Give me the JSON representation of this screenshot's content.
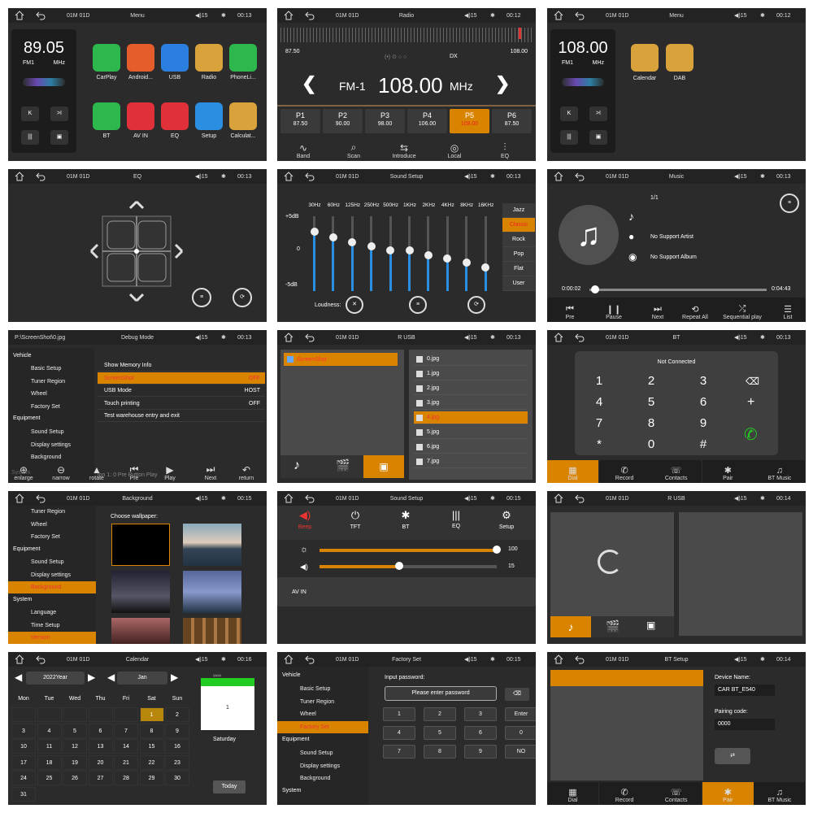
{
  "status": [
    {
      "sid": "01M 01D",
      "title": "Menu",
      "vol": "15",
      "time": "00:13"
    },
    {
      "sid": "01M 01D",
      "title": "Radio",
      "vol": "15",
      "time": "00:12"
    },
    {
      "sid": "01M 01D",
      "title": "Menu",
      "vol": "15",
      "time": "00:12"
    },
    {
      "sid": "01M 01D",
      "title": "EQ",
      "vol": "15",
      "time": "00:13"
    },
    {
      "sid": "01M 01D",
      "title": "Sound Setup",
      "vol": "15",
      "time": "00:13"
    },
    {
      "sid": "01M 01D",
      "title": "Music",
      "vol": "15",
      "time": "00:13"
    },
    {
      "sid": "P:\\ScreenShot\\0.jpg",
      "title": "Debug Mode",
      "vol": "15",
      "time": "00:13"
    },
    {
      "sid": "01M 01D",
      "title": "R USB",
      "vol": "15",
      "time": "00:13"
    },
    {
      "sid": "01M 01D",
      "title": "BT",
      "vol": "15",
      "time": "00:13"
    },
    {
      "sid": "01M 01D",
      "title": "Background",
      "vol": "15",
      "time": "00:15"
    },
    {
      "sid": "01M 01D",
      "title": "Sound Setup",
      "vol": "15",
      "time": "00:15"
    },
    {
      "sid": "01M 01D",
      "title": "R USB",
      "vol": "15",
      "time": "00:14"
    },
    {
      "sid": "01M 01D",
      "title": "Calendar",
      "vol": "15",
      "time": "00:16"
    },
    {
      "sid": "01M 01D",
      "title": "Factory Set",
      "vol": "15",
      "time": "00:15"
    },
    {
      "sid": "01M 01D",
      "title": "BT Setup",
      "vol": "15",
      "time": "00:14"
    }
  ],
  "menu1": {
    "freq": "89.05",
    "band": "FM1",
    "unit": "MHz",
    "apps": [
      "CarPlay",
      "Android...",
      "USB",
      "Radio",
      "PhoneLi...",
      "BT",
      "AV IN",
      "EQ",
      "Setup",
      "Calculat..."
    ],
    "colors": [
      "#2db84d",
      "#e45d2a",
      "#2a7fe0",
      "#d9a23a",
      "#2db84d",
      "#2db84d",
      "#e0303a",
      "#e0303a",
      "#2a8fe0",
      "#d9a23a"
    ]
  },
  "radio": {
    "min": "87.50",
    "max": "108.00",
    "dx": "DX",
    "band": "FM-1",
    "freq": "108.00",
    "unit": "MHz",
    "presets": [
      {
        "p": "P1",
        "f": "87.50"
      },
      {
        "p": "P2",
        "f": "90.00"
      },
      {
        "p": "P3",
        "f": "98.00"
      },
      {
        "p": "P4",
        "f": "106.00"
      },
      {
        "p": "P5",
        "f": "108.00"
      },
      {
        "p": "P6",
        "f": "87.50"
      }
    ],
    "buttons": [
      "Band",
      "Scan",
      "Introduce",
      "Local",
      "EQ"
    ]
  },
  "menu2": {
    "freq": "108.00",
    "band": "FM1",
    "unit": "MHz",
    "apps": [
      "Calendar",
      "DAB"
    ]
  },
  "sound": {
    "freqs": [
      "30Hz",
      "60Hz",
      "125Hz",
      "250Hz",
      "500Hz",
      "1KHz",
      "2KHz",
      "4KHz",
      "8KHz",
      "16KHz"
    ],
    "levels": [
      0.79,
      0.72,
      0.65,
      0.6,
      0.54,
      0.54,
      0.48,
      0.43,
      0.38,
      0.31
    ],
    "top": "+5dB",
    "mid": "0",
    "bot": "-5dB",
    "presets": [
      "Jazz",
      "Classic",
      "Rock",
      "Pop",
      "Flat",
      "User"
    ],
    "loudness": "Loudness:"
  },
  "music": {
    "track": "1/1",
    "artist": "No Support Artist",
    "album": "No Support Album",
    "cur": "0:00:02",
    "total": "0:04:43",
    "progress": 0.03,
    "buttons": [
      "Pre",
      "Pause",
      "Next",
      "Repeat All",
      "Sequential play",
      "List"
    ]
  },
  "debug": {
    "groups": [
      "Vehicle",
      "Equipment",
      "System"
    ],
    "vehicle": [
      "Basic Setup",
      "Tuner Region",
      "Wheel",
      "Factory Set"
    ],
    "equipment": [
      "Sound Setup",
      "Display settings",
      "Background"
    ],
    "items": [
      {
        "k": "Show Memory Info",
        "v": ""
      },
      {
        "k": "ScreenShot",
        "v": "OFF"
      },
      {
        "k": "USB Mode",
        "v": "HOST"
      },
      {
        "k": "Touch printing",
        "v": "OFF"
      },
      {
        "k": "Test warehouse entry and exit",
        "v": ""
      }
    ],
    "tools": [
      "enlarge",
      "narrow",
      "rotate",
      "Pre",
      "Play",
      "Next",
      "return"
    ],
    "ghost": "ion 1:  0   Pre   Button  Play"
  },
  "rusb": {
    "folder": "ScreenShot",
    "files": [
      "0.jpg",
      "1.jpg",
      "2.jpg",
      "3.jpg",
      "4.jpg",
      "5.jpg",
      "6.jpg",
      "7.jpg"
    ]
  },
  "bt": {
    "state": "Not Connected",
    "keys": [
      "1",
      "2",
      "3",
      "4",
      "5",
      "6",
      "7",
      "8",
      "9",
      "*",
      "0",
      "#"
    ],
    "plus": "+",
    "tabs": [
      "Dial",
      "Record",
      "Contacts",
      "Pair",
      "BT Music"
    ]
  },
  "bg": {
    "choose": "Choose wallpaper:",
    "left": [
      "Tuner Region",
      "Wheel",
      "Factory Set",
      "Equipment",
      "Sound Setup",
      "Display settings",
      "Background",
      "System",
      "Language",
      "Time Setup",
      "Version"
    ]
  },
  "sound2": {
    "icons": [
      "Beep",
      "TFT",
      "BT",
      "EQ",
      "Setup"
    ],
    "v1": "100",
    "v2": "15",
    "av": "AV IN",
    "s1": 1.0,
    "s2": 0.45
  },
  "cal": {
    "year": "2022Year",
    "month": "Jan",
    "days": [
      "Mon",
      "Tue",
      "Wed",
      "Thu",
      "Fri",
      "Sat",
      "Sun"
    ],
    "dates": [
      "",
      "",
      "",
      "",
      "",
      "1",
      "2",
      "3",
      "4",
      "5",
      "6",
      "7",
      "8",
      "9",
      "10",
      "11",
      "12",
      "13",
      "14",
      "15",
      "16",
      "17",
      "18",
      "19",
      "20",
      "21",
      "22",
      "23",
      "24",
      "25",
      "26",
      "27",
      "28",
      "29",
      "30",
      "31"
    ],
    "sel": "1",
    "dow": "Saturday",
    "today": "Today"
  },
  "factory": {
    "left": [
      "Vehicle",
      "Basic Setup",
      "Tuner Region",
      "Wheel",
      "Factory Set",
      "Equipment",
      "Sound Setup",
      "Display settings",
      "Background",
      "System"
    ],
    "prompt": "Input password:",
    "placeholder": "Please enter password",
    "keys": [
      "1",
      "2",
      "3",
      "Enter",
      "4",
      "5",
      "6",
      "0",
      "7",
      "8",
      "9",
      "NO"
    ]
  },
  "btsetup": {
    "devlabel": "Device Name:",
    "dev": "CAR BT_E540",
    "pinlabel": "Pairing code:",
    "pin": "0000"
  }
}
